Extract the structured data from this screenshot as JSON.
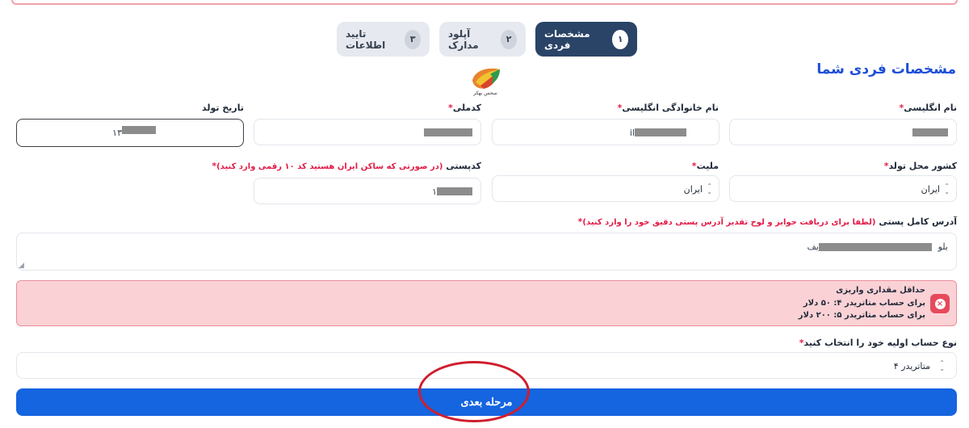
{
  "stepper": [
    {
      "num": "۱",
      "label": "مشخصات فردی",
      "active": true
    },
    {
      "num": "۲",
      "label": "آپلود مدارک",
      "active": false
    },
    {
      "num": "۳",
      "label": "تایید اطلاعات",
      "active": false
    }
  ],
  "section_title": "مشخصات فردی شما",
  "logo_caption": "سحس بهکر",
  "fields": {
    "first_name_en": {
      "label": "نام انگلیسی",
      "required": "*"
    },
    "last_name_en": {
      "label": "نام خانوادگی انگلیسی",
      "required": "*",
      "value_prefix": "il"
    },
    "national_code": {
      "label": "کدملی",
      "required": "*"
    },
    "birth_date": {
      "label": "تاریخ تولد",
      "value_prefix": "۱۳"
    },
    "birth_country": {
      "label": "کشور محل تولد",
      "required": "*",
      "value": "ایران"
    },
    "nationality": {
      "label": "ملیت",
      "required": "*",
      "value": "ایران"
    },
    "postal_code": {
      "label": "کدپستی",
      "hint": "(در صورتی که ساکن ایران هستید کد ۱۰ رقمی وارد کنید)",
      "required": "*",
      "value_prefix": "۱"
    },
    "address": {
      "label": "آدرس کامل پستی",
      "hint": "(لطفا برای دریافت جوایز و لوح تقدیر آدرس پستی دقیق خود را وارد کنید)",
      "required": "*",
      "value_start": "بلو",
      "value_end": "یف"
    },
    "account_type": {
      "label": "نوع حساب اولیه خود را انتخاب کنید",
      "required": "*",
      "value": "متاتریدر ۴"
    }
  },
  "alert": {
    "title": "حداقل مقداری واریزی",
    "line1": "برای حساب متاتریدر ۴: ۵۰ دلار",
    "line2": "برای حساب متاتریدر ۵: ۲۰۰ دلار"
  },
  "next_button": "مرحله بعدی",
  "colors": {
    "primary": "#1565e0",
    "step_active": "#2a4467",
    "alert_bg": "#fad2d6",
    "required": "#e11d48",
    "annotation": "#d01d2d"
  }
}
